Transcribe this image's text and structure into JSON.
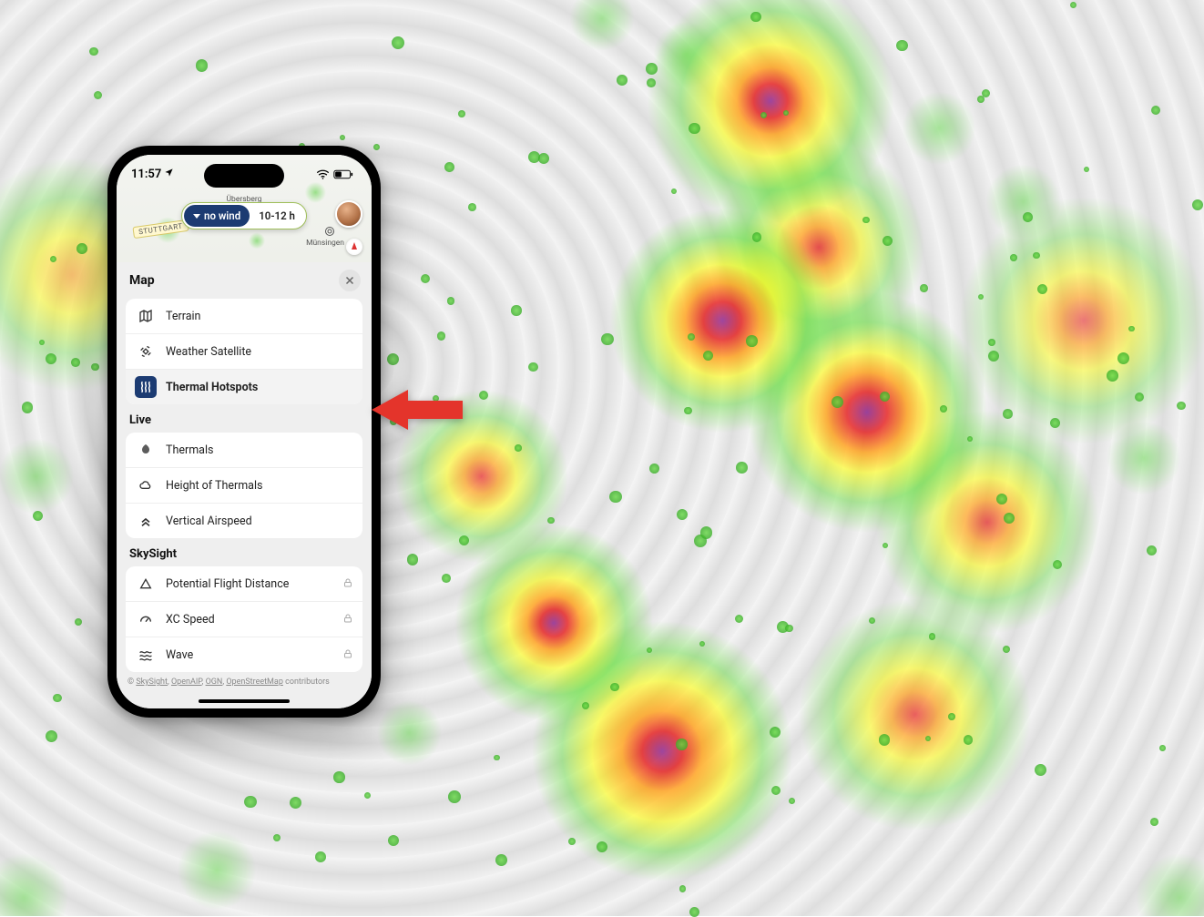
{
  "statusbar": {
    "time": "11:57"
  },
  "top_chips": {
    "wind": "no wind",
    "time_range": "10-12 h"
  },
  "map_labels": {
    "stuttgart": "STUTTGART",
    "ubersberg": "Übersberg",
    "munsingen": "Münsingen"
  },
  "sheet": {
    "title": "Map",
    "sections": {
      "map": {
        "title": "Map",
        "items": [
          {
            "label": "Terrain",
            "icon": "map-icon",
            "selected": false
          },
          {
            "label": "Weather Satellite",
            "icon": "satellite-icon",
            "selected": false
          },
          {
            "label": "Thermal Hotspots",
            "icon": "heat-icon",
            "selected": true
          }
        ]
      },
      "live": {
        "title": "Live",
        "items": [
          {
            "label": "Thermals",
            "icon": "thermal-blob-icon"
          },
          {
            "label": "Height of Thermals",
            "icon": "cloud-icon"
          },
          {
            "label": "Vertical Airspeed",
            "icon": "chevrons-up-icon"
          }
        ]
      },
      "skysight": {
        "title": "SkySight",
        "items": [
          {
            "label": "Potential Flight Distance",
            "icon": "triangle-icon",
            "locked": true
          },
          {
            "label": "XC Speed",
            "icon": "gauge-icon",
            "locked": true
          },
          {
            "label": "Wave",
            "icon": "wave-icon",
            "locked": true
          }
        ]
      }
    }
  },
  "attribution": {
    "prefix": "© ",
    "links": [
      "SkySight",
      "OpenAIP",
      "OGN",
      "OpenStreetMap"
    ],
    "suffix": " contributors"
  }
}
